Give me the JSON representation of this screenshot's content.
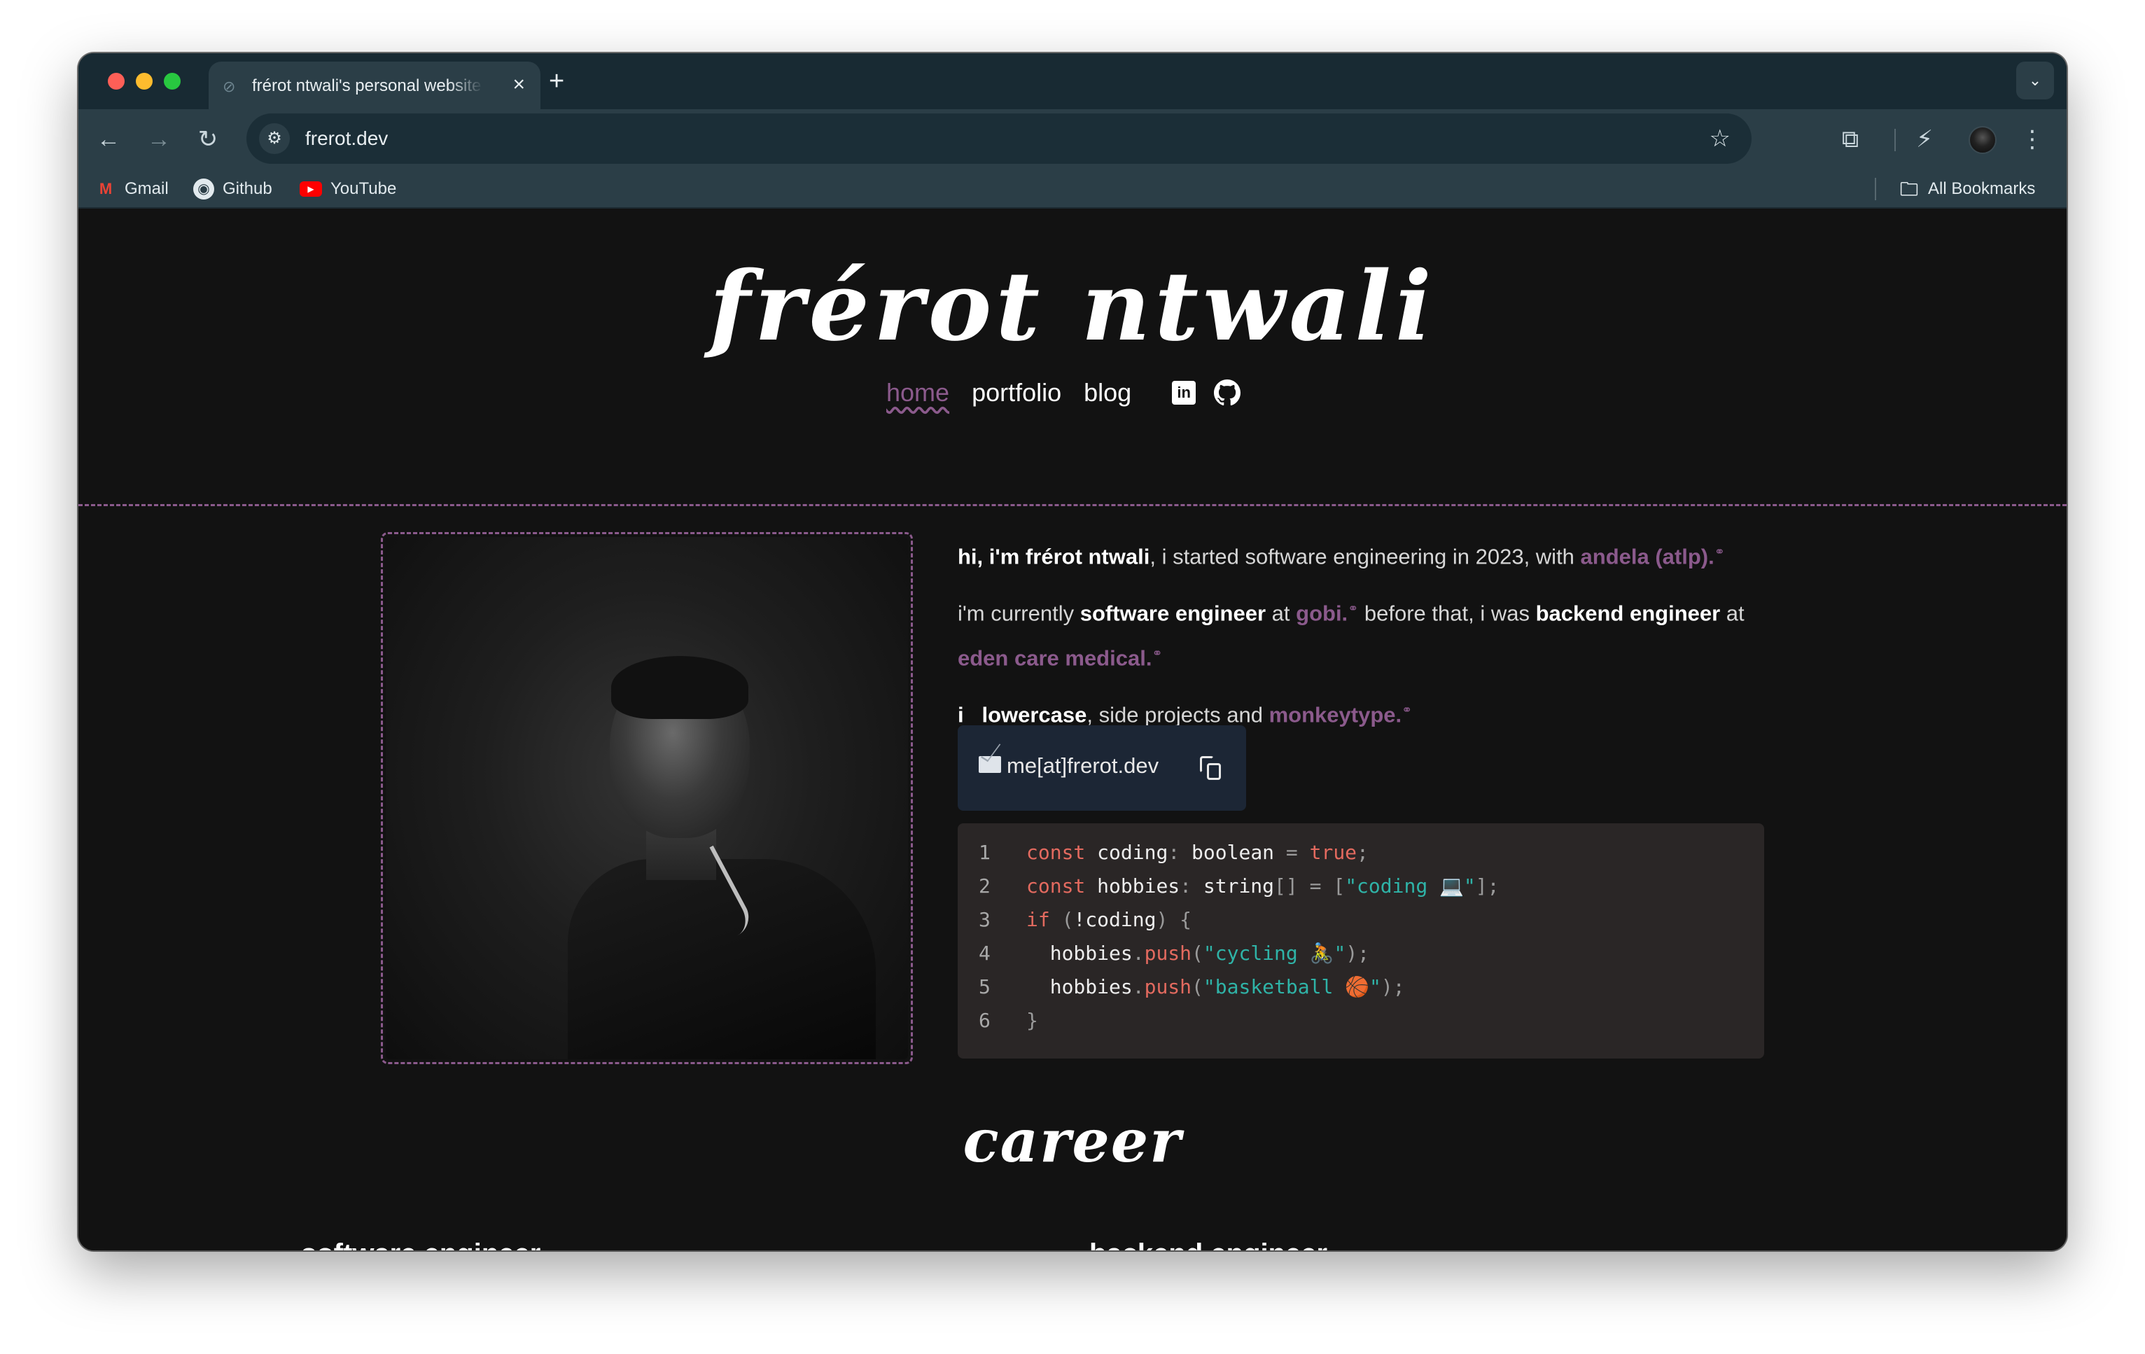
{
  "browser": {
    "tab_title": "frérot ntwali's personal website",
    "tab_close_icon": "×",
    "new_tab_icon": "+",
    "url": "frerot.dev",
    "bookmarks": [
      {
        "label": "Gmail",
        "icon": "gmail-icon"
      },
      {
        "label": "Github",
        "icon": "github-icon"
      },
      {
        "label": "YouTube",
        "icon": "youtube-icon"
      }
    ],
    "all_bookmarks": "All Bookmarks",
    "colors": {
      "tab_strip": "#182a33",
      "toolbar": "#2b3e47"
    }
  },
  "site": {
    "title": "frérot ntwali",
    "nav": {
      "home": "home",
      "portfolio": "portfolio",
      "blog": "blog"
    },
    "social_icons": [
      "linkedin-icon",
      "github-icon"
    ],
    "accent_color": "#8b5a8c",
    "intro": {
      "p1_bold": "hi, i'm frérot ntwali",
      "p1_text": ", i started software engineering in 2023, with ",
      "p1_link": "andela (atlp).",
      "p2_text_a": "i'm currently ",
      "p2_bold_a": "software engineer",
      "p2_text_b": " at ",
      "p2_link_a": "gobi.",
      "p2_text_c": " before that, i was ",
      "p2_bold_b": "backend engineer",
      "p2_text_d": " at ",
      "p2_link_b": "eden care medical.",
      "p3_i": "i",
      "p3_bold": "lowercase",
      "p3_text": ", side projects and ",
      "p3_link": "monkeytype."
    },
    "email": "me[at]frerot.dev",
    "code": {
      "line_numbers": [
        "1",
        "2",
        "3",
        "4",
        "5",
        "6"
      ],
      "l1": {
        "kw": "const",
        "name": " coding",
        "colon": ":",
        "type": " boolean",
        "eq": " =",
        "val": " true",
        "end": ";"
      },
      "l2": {
        "kw": "const",
        "name": " hobbies",
        "colon": ":",
        "type": " string",
        "br": "[]",
        "eq": " =",
        "open": " [",
        "str": "\"coding 💻\"",
        "close": "];"
      },
      "l3": {
        "kw": "if",
        "open": " (",
        "not": "!",
        "name": "coding",
        "close": ") {"
      },
      "l4": {
        "indent": "  ",
        "obj": "hobbies",
        "dot": ".",
        "fn": "push",
        "open": "(",
        "str": "\"cycling 🚴\"",
        "close": ");"
      },
      "l5": {
        "indent": "  ",
        "obj": "hobbies",
        "dot": ".",
        "fn": "push",
        "open": "(",
        "str": "\"basketball 🏀\"",
        "close": ");"
      },
      "l6": {
        "close": "}"
      }
    },
    "career_heading": "career",
    "jobs": [
      "software engineer",
      "backend engineer"
    ]
  }
}
